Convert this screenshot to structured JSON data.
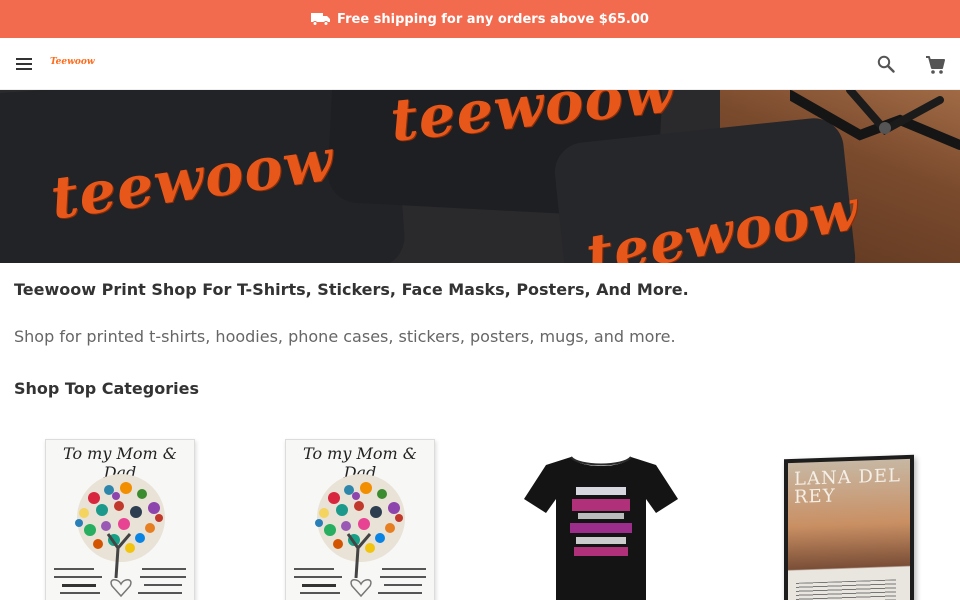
{
  "announcement": {
    "text": "Free shipping for any orders above $65.00",
    "icon": "truck-icon",
    "background": "#f26b4f"
  },
  "header": {
    "logo_text": "Teewoow",
    "menu_icon": "hamburger-menu-icon",
    "search_icon": "search-icon",
    "cart_icon": "cart-icon"
  },
  "hero": {
    "brand_text": "teewoow"
  },
  "main": {
    "headline": "Teewoow Print Shop For T-Shirts, Stickers, Face Masks, Posters, And More.",
    "subline": "Shop for printed t-shirts, hoodies, phone cases, stickers, posters, mugs, and more.",
    "categories_title": "Shop Top Categories"
  },
  "categories": [
    {
      "image": "mom-dad-blanket",
      "card_title": "To my Mom & Dad"
    },
    {
      "image": "mom-dad-blanket",
      "card_title": "To my Mom & Dad"
    },
    {
      "image": "black-printed-tshirt",
      "card_title": ""
    },
    {
      "image": "lana-del-rey-poster",
      "card_title": "LANA DEL REY"
    }
  ],
  "colors": {
    "accent": "#f26b4f",
    "brand_orange": "#e8571a",
    "text_dark": "#333333",
    "text_muted": "#666666"
  }
}
